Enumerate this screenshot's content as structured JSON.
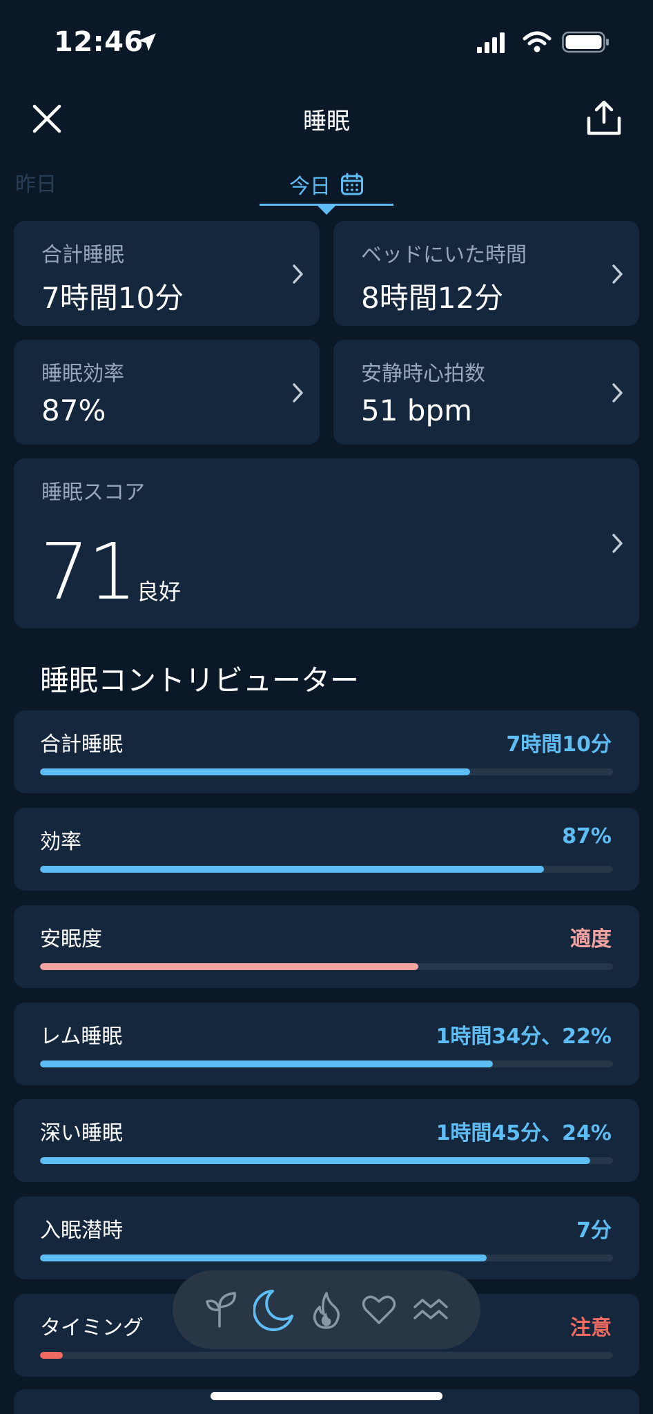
{
  "status_bar": {
    "time": "12:46"
  },
  "header": {
    "title": "睡眠"
  },
  "tabs": {
    "yesterday": "昨日",
    "today": "今日"
  },
  "metrics": [
    {
      "label": "合計睡眠",
      "value": "7時間10分"
    },
    {
      "label": "ベッドにいた時間",
      "value": "8時間12分"
    },
    {
      "label": "睡眠効率",
      "value": "87%"
    },
    {
      "label": "安静時心拍数",
      "value": "51 bpm"
    }
  ],
  "score": {
    "label": "睡眠スコア",
    "value": "71",
    "rating": "良好"
  },
  "contributors": {
    "title": "睡眠コントリビューター",
    "items": [
      {
        "label": "合計睡眠",
        "value": "7時間10分",
        "progress": 0.75,
        "color": "#5fbdf5"
      },
      {
        "label": "効率",
        "value": "87%",
        "progress": 0.88,
        "color": "#5fbdf5"
      },
      {
        "label": "安眠度",
        "value": "適度",
        "progress": 0.66,
        "color": "#f3a3a0"
      },
      {
        "label": "レム睡眠",
        "value": "1時間34分、22%",
        "progress": 0.79,
        "color": "#5fbdf5"
      },
      {
        "label": "深い睡眠",
        "value": "1時間45分、24%",
        "progress": 0.96,
        "color": "#5fbdf5"
      },
      {
        "label": "入眠潜時",
        "value": "7分",
        "progress": 0.78,
        "color": "#5fbdf5"
      },
      {
        "label": "タイミング",
        "value": "注意",
        "progress": 0.04,
        "color": "#ef6a60"
      }
    ]
  },
  "colors": {
    "background": "#0b1827",
    "card": "#15273d",
    "accent": "#5fbdf5",
    "warning": "#ef6a60",
    "moderate": "#f3a3a0"
  },
  "bottom_nav": {
    "items": [
      "sprout-icon",
      "moon-icon",
      "flame-icon",
      "heart-icon",
      "waves-icon"
    ],
    "active": "moon-icon"
  }
}
